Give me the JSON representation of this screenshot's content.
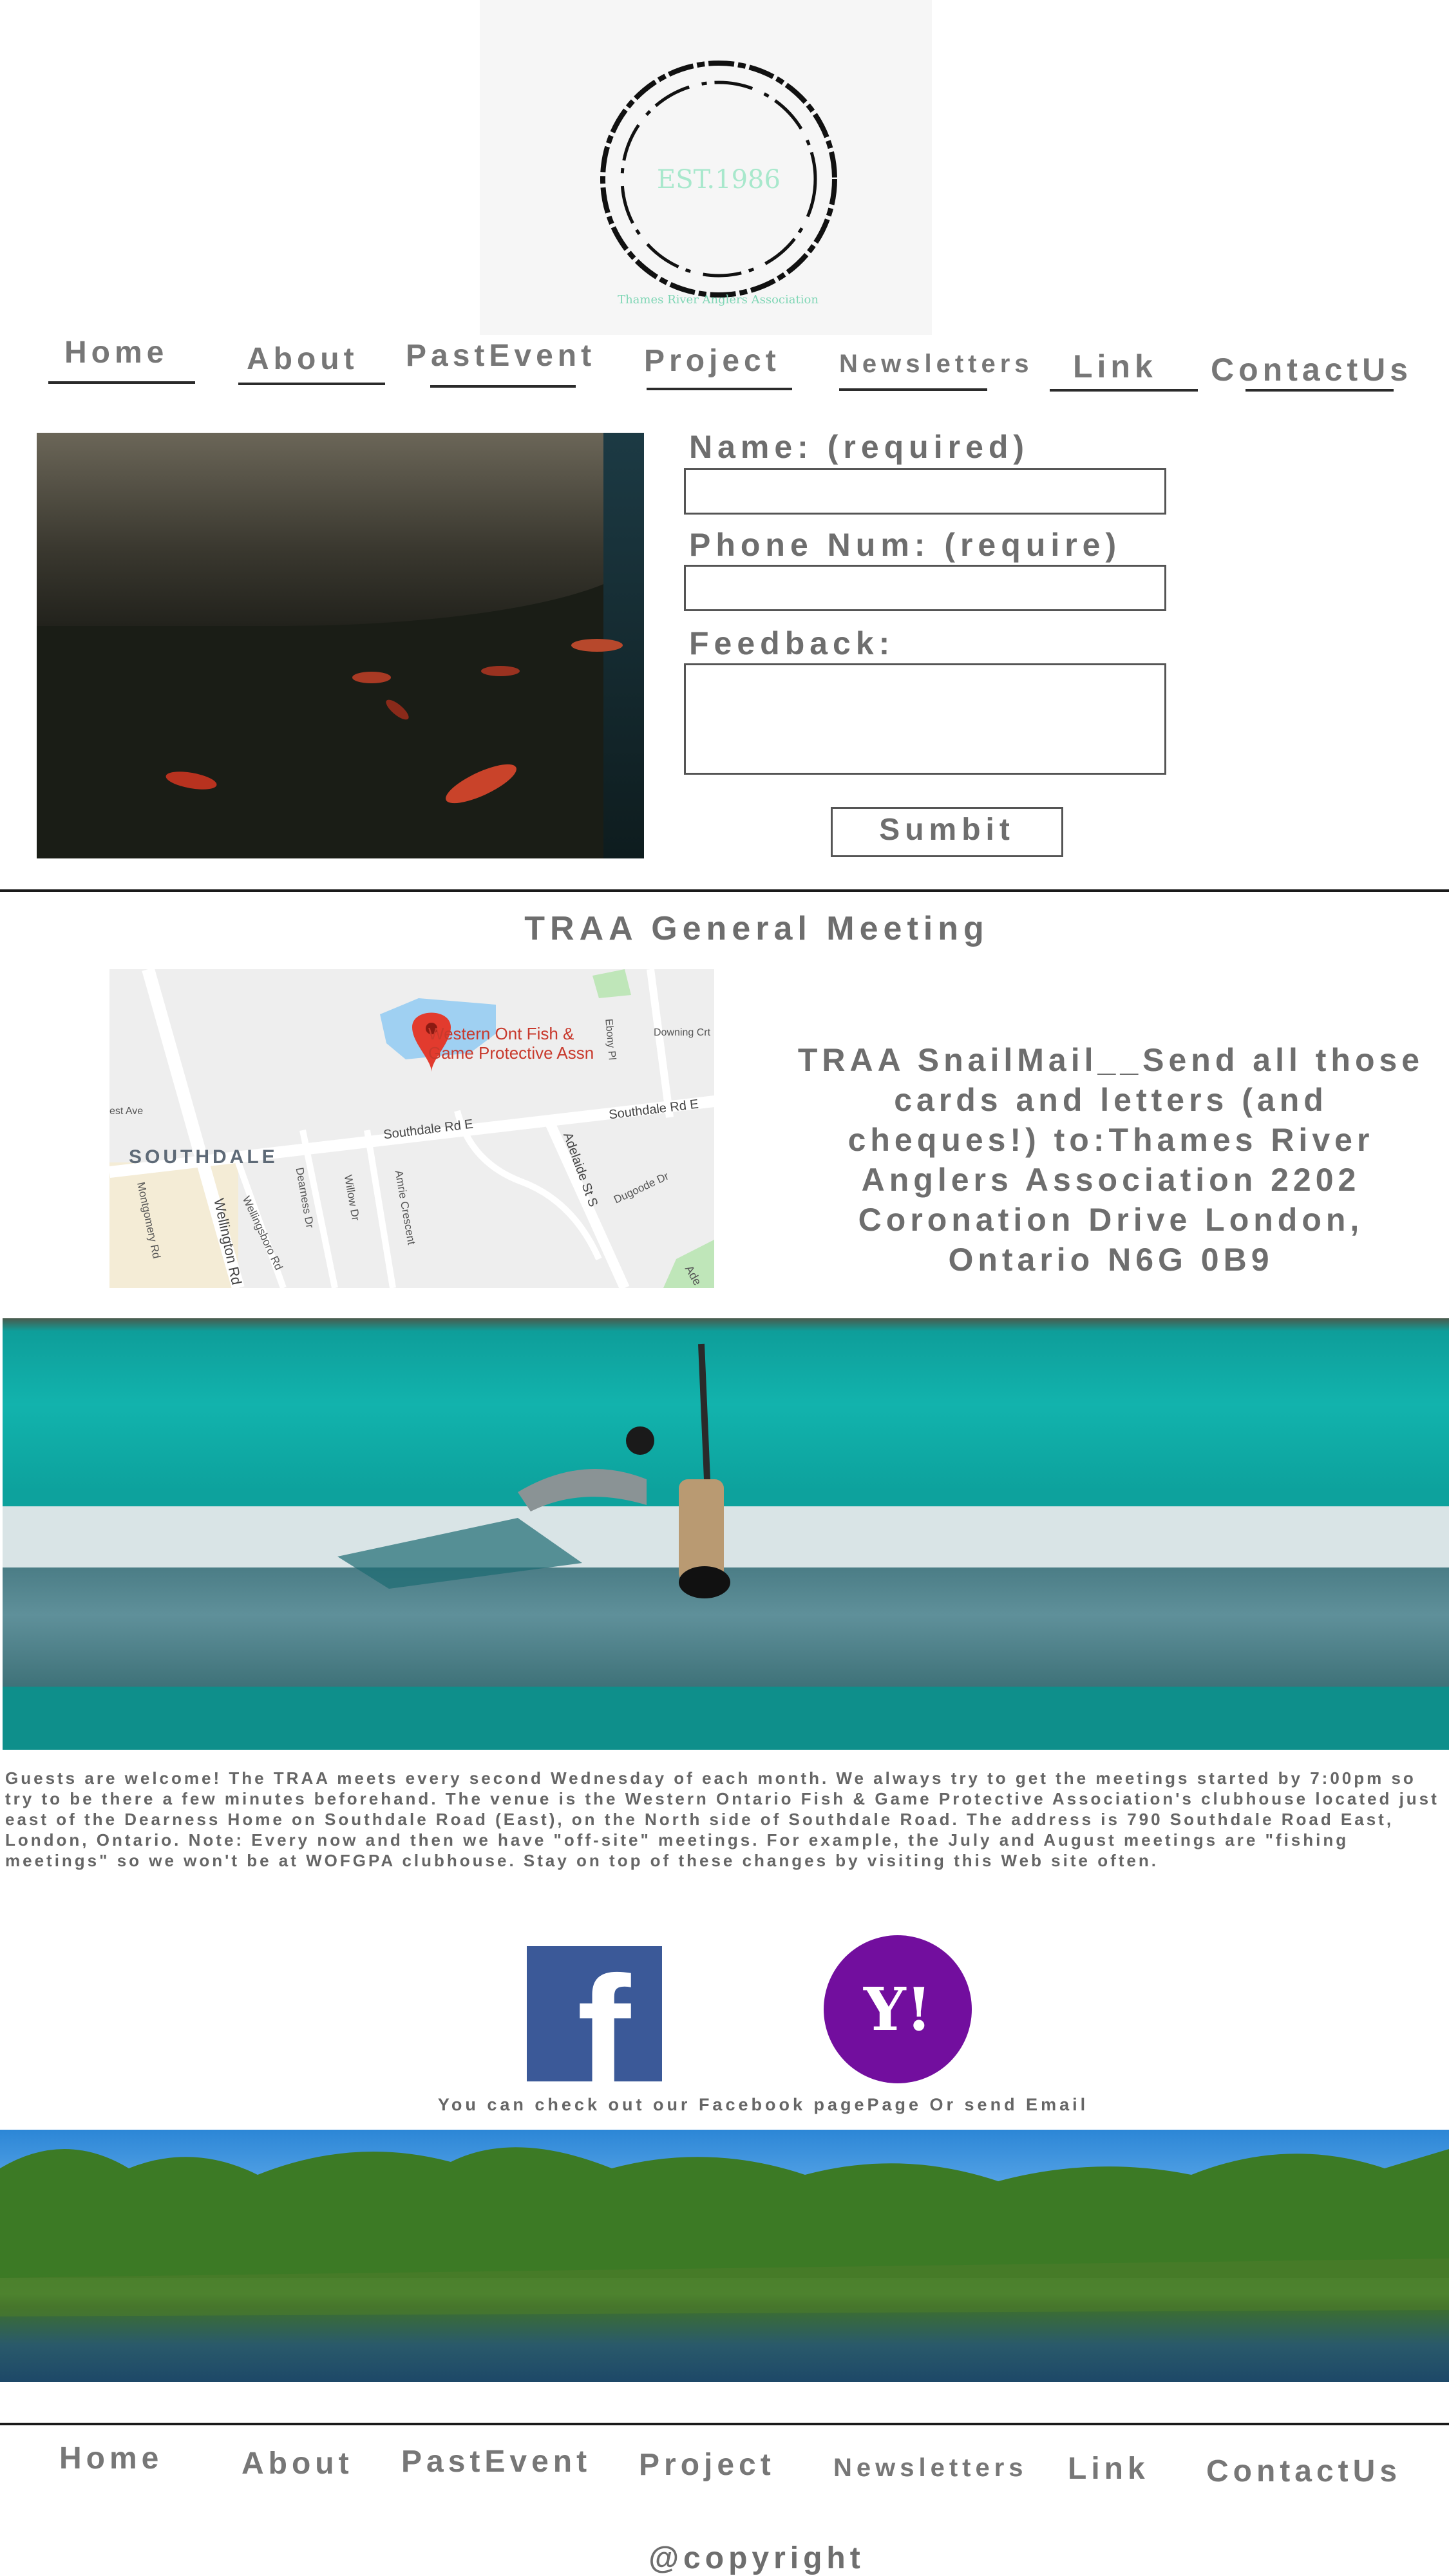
{
  "logo": {
    "text": "EST.1986",
    "caption": "Thames River Anglers Association"
  },
  "nav": {
    "items": [
      {
        "label": "Home"
      },
      {
        "label": "About"
      },
      {
        "label": "PastEvent"
      },
      {
        "label": "Project"
      },
      {
        "label": "Newsletters"
      },
      {
        "label": "Link"
      },
      {
        "label": "ContactUs"
      }
    ]
  },
  "form": {
    "name_label": "Name: (required)",
    "phone_label": "Phone Num: (require)",
    "feedback_label": "Feedback:",
    "submit_label": "Sumbit"
  },
  "meeting": {
    "title": "TRAA General Meeting",
    "snailmail": "TRAA SnailMail__Send all those cards and letters (and cheques!) to:Thames River Anglers Association 2202 Coronation Drive London, Ontario N6G 0B9"
  },
  "map": {
    "place_name": "Western Ont Fish & Game Protective Assn",
    "roads": [
      "Southdale Rd E",
      "Southdale Rd E",
      "Adelaide St S",
      "Wellington Rd",
      "Montgomery Rd",
      "Wellingsboro Rd",
      "Dearness Dr",
      "Willow Dr",
      "Amrie Crescent",
      "Dugoode Dr",
      "Downing Crt",
      "Ebony Pl",
      "Ade",
      "est Ave"
    ],
    "area": "SOUTHDALE"
  },
  "info_paragraph": "Guests are welcome! The TRAA meets every second Wednesday of each month. We always try to get the meetings started by 7:00pm so try to be there a few minutes beforehand. The venue is the Western Ontario Fish & Game Protective Association's clubhouse located just east of the Dearness Home on Southdale Road (East), on the North side of Southdale Road. The address is 790 Southdale Road East, London, Ontario. Note: Every now and then we have \"off-site\" meetings. For example, the July and August meetings are \"fishing meetings\" so we won't be at WOFGPA clubhouse. Stay on top of these changes by visiting this Web site often.",
  "social": {
    "caption": "You can check out our Facebook pagePage Or send Email",
    "facebook_glyph": "f",
    "yahoo_glyph": "Y!"
  },
  "footer_nav": {
    "items": [
      {
        "label": "Home"
      },
      {
        "label": "About"
      },
      {
        "label": "PastEvent"
      },
      {
        "label": "Project"
      },
      {
        "label": "Newsletters"
      },
      {
        "label": "Link"
      },
      {
        "label": "ContactUs"
      }
    ]
  },
  "copyright": "@copyright",
  "colors": {
    "facebook": "#3b5998",
    "yahoo": "#720e9e",
    "water": "#0ea5a0",
    "divider": "#1a1a1a"
  }
}
